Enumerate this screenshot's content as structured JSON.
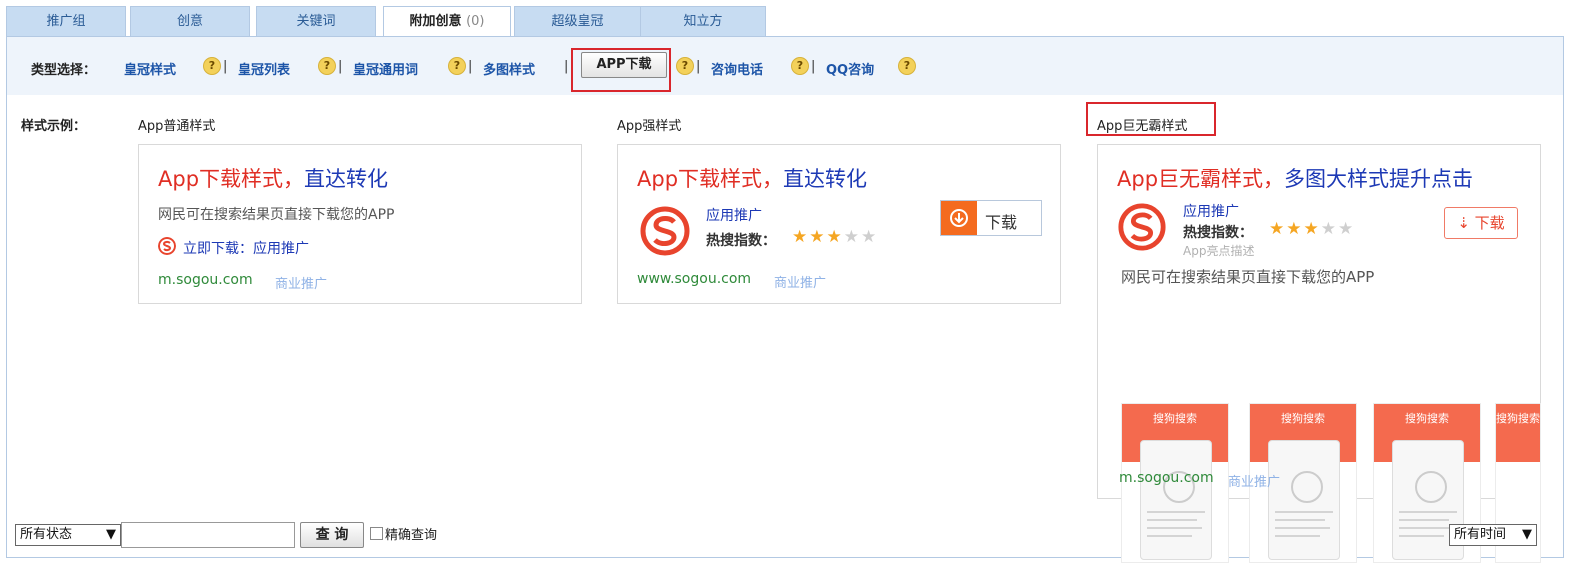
{
  "tabs": [
    {
      "label": "推广组"
    },
    {
      "label": "创意"
    },
    {
      "label": "关键词"
    },
    {
      "label": "附加创意",
      "count": "(0)"
    },
    {
      "label": "超级皇冠"
    },
    {
      "label": "知立方"
    }
  ],
  "typebar": {
    "label": "类型选择：",
    "items": [
      "皇冠样式",
      "皇冠列表",
      "皇冠通用词",
      "多图样式",
      "APP下载",
      "咨询电话",
      "QQ咨询"
    ],
    "help": "?",
    "separator": "|"
  },
  "examples": {
    "row_label": "样式示例：",
    "normal": {
      "label": "App普通样式",
      "title_red": "App下载样式，",
      "title_blue": "直达转化",
      "desc": "网民可在搜索结果页直接下载您的APP",
      "link": "立即下载：应用推广",
      "url": "m.sogou.com",
      "ad": "商业推广"
    },
    "strong": {
      "label": "App强样式",
      "title_red": "App下载样式，",
      "title_blue": "直达转化",
      "app_name": "应用推广",
      "hot_label": "热搜指数：",
      "rating": 3,
      "rating_max": 5,
      "download": "下载",
      "url": "www.sogou.com",
      "ad": "商业推广"
    },
    "giant": {
      "label": "App巨无霸样式",
      "title_red": "App巨无霸样式，",
      "title_blue": "多图大样式提升点击",
      "app_name": "应用推广",
      "hot_label": "热搜指数：",
      "rating": 3,
      "rating_max": 5,
      "sub": "App亮点描述",
      "download": "下载",
      "desc": "网民可在搜索结果页直接下载您的APP",
      "shot_title": "搜狗搜索",
      "url": "m.sogou.com",
      "ad": "商业推广"
    }
  },
  "filter": {
    "status": "所有状态",
    "query_btn": "查 询",
    "exact": "精确查询",
    "time": "所有时间"
  },
  "colors": {
    "accent_red": "#d9262c",
    "tab_bg": "#c7dcf2",
    "link_blue": "#1d55a8",
    "title_red": "#e02e24",
    "title_blue": "#1d39b5"
  }
}
